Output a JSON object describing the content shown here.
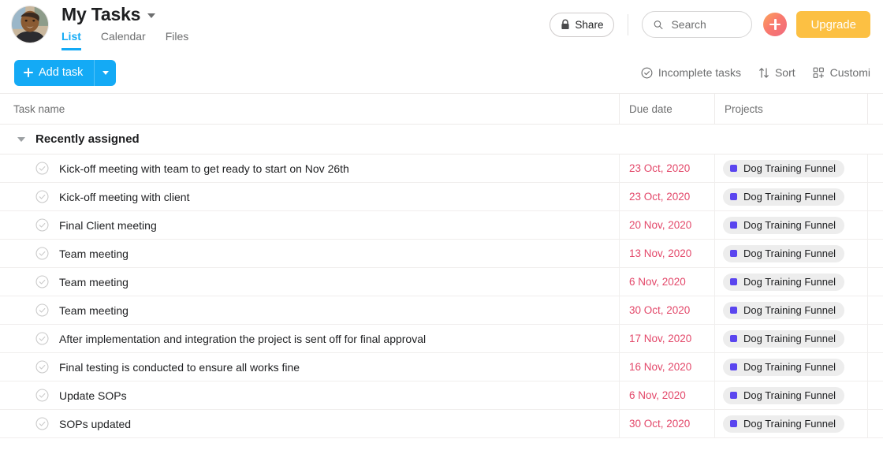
{
  "header": {
    "title": "My Tasks",
    "title_caret_icon": "chevron-down-icon",
    "avatar_alt": "user-avatar",
    "tabs": [
      {
        "label": "List",
        "active": true
      },
      {
        "label": "Calendar",
        "active": false
      },
      {
        "label": "Files",
        "active": false
      }
    ],
    "share_label": "Share",
    "share_icon": "lock-icon",
    "search_placeholder": "Search",
    "search_value": "",
    "search_icon": "search-icon",
    "quick_add_icon": "plus-icon",
    "upgrade_label": "Upgrade"
  },
  "toolbar": {
    "add_task_label": "Add task",
    "add_task_icon": "plus-icon",
    "add_task_caret_icon": "chevron-down-icon",
    "filter_label": "Incomplete tasks",
    "filter_icon": "check-circle-icon",
    "sort_label": "Sort",
    "sort_icon": "sort-arrows-icon",
    "customize_label": "Customi",
    "customize_icon": "customize-grid-icon"
  },
  "table": {
    "columns": {
      "task_name": "Task name",
      "due_date": "Due date",
      "projects": "Projects"
    },
    "section": {
      "title": "Recently assigned",
      "caret_icon": "triangle-down-icon",
      "expanded": true
    },
    "rows": [
      {
        "name": "Kick-off meeting with team to get ready to start on Nov 26th",
        "due": "23 Oct, 2020",
        "project": "Dog Training Funnel"
      },
      {
        "name": "Kick-off meeting with client",
        "due": "23 Oct, 2020",
        "project": "Dog Training Funnel"
      },
      {
        "name": "Final Client meeting",
        "due": "20 Nov, 2020",
        "project": "Dog Training Funnel"
      },
      {
        "name": "Team meeting",
        "due": "13 Nov, 2020",
        "project": "Dog Training Funnel"
      },
      {
        "name": "Team meeting",
        "due": "6 Nov, 2020",
        "project": "Dog Training Funnel"
      },
      {
        "name": "Team meeting",
        "due": "30 Oct, 2020",
        "project": "Dog Training Funnel"
      },
      {
        "name": "After implementation and integration the project is sent off for final approval",
        "due": "17 Nov, 2020",
        "project": "Dog Training Funnel"
      },
      {
        "name": "Final testing is conducted to ensure all works fine",
        "due": "16 Nov, 2020",
        "project": "Dog Training Funnel"
      },
      {
        "name": "Update SOPs",
        "due": "6 Nov, 2020",
        "project": "Dog Training Funnel"
      },
      {
        "name": "SOPs updated",
        "due": "30 Oct, 2020",
        "project": "Dog Training Funnel"
      }
    ]
  },
  "colors": {
    "accent_blue": "#14AAF5",
    "upgrade_amber": "#FCC043",
    "due_date_red": "#E3486A",
    "project_dot_purple": "#5A45EF",
    "pill_bg": "#EDEDED",
    "text_primary": "#1E1F21",
    "text_secondary": "#6D6E6F",
    "border": "#EDEAE9"
  }
}
